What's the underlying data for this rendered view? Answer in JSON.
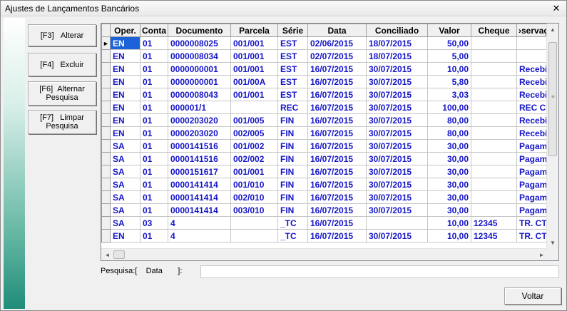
{
  "window": {
    "title": "Ajustes de Lançamentos Bancários",
    "close_glyph": "✕"
  },
  "buttons": {
    "alterar": {
      "key": "[F3]",
      "label": "Alterar"
    },
    "excluir": {
      "key": "[F4]",
      "label": "Excluir"
    },
    "alternar": {
      "key": "[F6]",
      "label": "Alternar",
      "label2": "Pesquisa"
    },
    "limpar": {
      "key": "[F7]",
      "label": "Limpar",
      "label2": "Pesquisa"
    }
  },
  "grid": {
    "columns": [
      "Oper.",
      "Conta",
      "Documento",
      "Parcela",
      "Série",
      "Data",
      "Conciliado",
      "Valor",
      "Cheque",
      "Observação"
    ],
    "columns_display": [
      "Oper.",
      "Conta",
      "Documento",
      "Parcela",
      "Série",
      "Data",
      "Conciliado",
      "Valor",
      "Cheque",
      "›servaçã"
    ],
    "row_indicator": "►",
    "rows": [
      [
        "EN",
        "01",
        "0000008025",
        "001/001",
        "EST",
        "02/06/2015",
        "18/07/2015",
        "50,00",
        "",
        ""
      ],
      [
        "EN",
        "01",
        "0000008034",
        "001/001",
        "EST",
        "02/07/2015",
        "18/07/2015",
        "5,00",
        "",
        ""
      ],
      [
        "EN",
        "01",
        "0000000001",
        "001/001",
        "EST",
        "16/07/2015",
        "30/07/2015",
        "10,00",
        "",
        "Recebi"
      ],
      [
        "EN",
        "01",
        "0000000001",
        "001/00A",
        "EST",
        "16/07/2015",
        "30/07/2015",
        "5,80",
        "",
        "Recebi"
      ],
      [
        "EN",
        "01",
        "0000008043",
        "001/001",
        "EST",
        "16/07/2015",
        "30/07/2015",
        "3,03",
        "",
        "Recebi"
      ],
      [
        "EN",
        "01",
        "000001/1",
        "",
        "REC",
        "16/07/2015",
        "30/07/2015",
        "100,00",
        "",
        "REC CL"
      ],
      [
        "EN",
        "01",
        "0000203020",
        "001/005",
        "FIN",
        "16/07/2015",
        "30/07/2015",
        "80,00",
        "",
        "Recebi"
      ],
      [
        "EN",
        "01",
        "0000203020",
        "002/005",
        "FIN",
        "16/07/2015",
        "30/07/2015",
        "80,00",
        "",
        "Recebi"
      ],
      [
        "SA",
        "01",
        "0000141516",
        "001/002",
        "FIN",
        "16/07/2015",
        "30/07/2015",
        "30,00",
        "",
        "Pagam"
      ],
      [
        "SA",
        "01",
        "0000141516",
        "002/002",
        "FIN",
        "16/07/2015",
        "30/07/2015",
        "30,00",
        "",
        "Pagam"
      ],
      [
        "SA",
        "01",
        "0000151617",
        "001/001",
        "FIN",
        "16/07/2015",
        "30/07/2015",
        "30,00",
        "",
        "Pagam"
      ],
      [
        "SA",
        "01",
        "0000141414",
        "001/010",
        "FIN",
        "16/07/2015",
        "30/07/2015",
        "30,00",
        "",
        "Pagam"
      ],
      [
        "SA",
        "01",
        "0000141414",
        "002/010",
        "FIN",
        "16/07/2015",
        "30/07/2015",
        "30,00",
        "",
        "Pagam"
      ],
      [
        "SA",
        "01",
        "0000141414",
        "003/010",
        "FIN",
        "16/07/2015",
        "30/07/2015",
        "30,00",
        "",
        "Pagam"
      ],
      [
        "SA",
        "03",
        "4",
        "",
        "_TC",
        "16/07/2015",
        "",
        "10,00",
        "12345",
        "TR. CT"
      ],
      [
        "EN",
        "01",
        "4",
        "",
        "_TC",
        "16/07/2015",
        "30/07/2015",
        "10,00",
        "12345",
        "TR. CT"
      ]
    ],
    "selected_row": 0
  },
  "search": {
    "label_prefix": "Pesquisa:[",
    "field_name": "Data",
    "label_suffix": "]:",
    "value": ""
  },
  "footer": {
    "voltar_label": "Voltar"
  },
  "colors": {
    "accent": "#1c62d8",
    "text_blue": "#1515c8",
    "sidebar_top": "#ffffff",
    "sidebar_bottom": "#1f8d79"
  }
}
